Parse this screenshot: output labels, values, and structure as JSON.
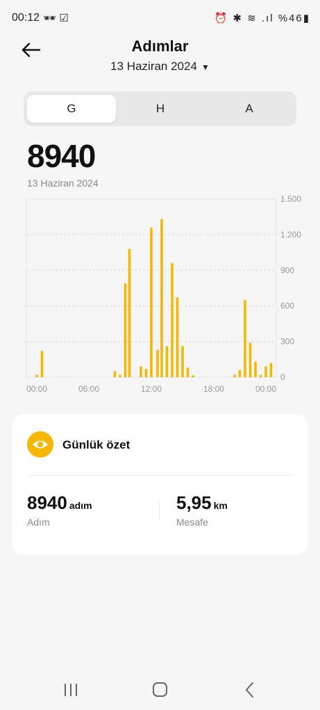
{
  "status_bar": {
    "time": "00:12",
    "battery": "%46"
  },
  "header": {
    "title": "Adımlar",
    "date_selector": "13 Haziran 2024"
  },
  "tabs": [
    {
      "label": "G",
      "active": true
    },
    {
      "label": "H",
      "active": false
    },
    {
      "label": "A",
      "active": false
    }
  ],
  "total": {
    "value": "8940",
    "date": "13 Haziran 2024"
  },
  "chart_data": {
    "type": "bar",
    "x_tick_labels": [
      "00:00",
      "06:00",
      "12:00",
      "18:00",
      "00:00"
    ],
    "y_tick_labels": [
      "1.500",
      "1.200",
      "900",
      "600",
      "300",
      "0"
    ],
    "ylim": [
      0,
      1500
    ],
    "xlim": [
      0,
      24
    ],
    "bar_color": "#f5b800",
    "x": [
      1.0,
      1.5,
      8.5,
      9.0,
      9.5,
      9.9,
      11.0,
      11.5,
      12.0,
      12.6,
      13.0,
      13.5,
      14.0,
      14.5,
      15.0,
      15.5,
      16.0,
      20.0,
      20.5,
      21.0,
      21.5,
      22.0,
      22.5,
      23.0,
      23.5
    ],
    "values": [
      20,
      220,
      50,
      20,
      790,
      1080,
      90,
      70,
      1260,
      230,
      1330,
      260,
      960,
      670,
      260,
      80,
      15,
      20,
      60,
      650,
      290,
      130,
      20,
      90,
      120
    ]
  },
  "summary": {
    "title": "Günlük özet",
    "steps_value": "8940",
    "steps_unit": "adım",
    "steps_label": "Adım",
    "distance_value": "5,95",
    "distance_unit": "km",
    "distance_label": "Mesafe"
  }
}
